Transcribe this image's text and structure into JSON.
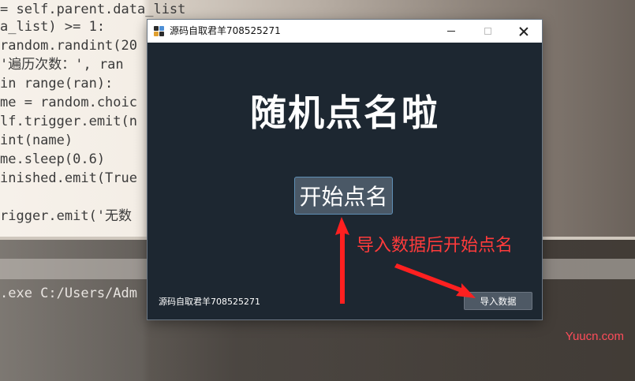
{
  "editor": {
    "code_lines": [
      "= self.parent.data_list",
      "a_list) >= 1:",
      "random.randint(20",
      "'遍历次数：', ran",
      "in range(ran):",
      "me = random.choic",
      "lf.trigger.emit(n",
      "int(name)",
      "me.sleep(0.6)",
      "inished.emit(True",
      "",
      "rigger.emit('无数"
    ],
    "terminal_line": ".exe C:/Users/Adm"
  },
  "window": {
    "title": "源码自取君羊708525271",
    "heading": "随机点名啦",
    "start_button_label": "开始点名",
    "hint_text": "导入数据后开始点名",
    "footer_text": "源码自取君羊708525271",
    "import_button_label": "导入数据"
  },
  "watermark": "Yuucn.com",
  "colors": {
    "window_bg": "#1d2731",
    "button_bg": "#4a5866",
    "accent_border": "#5f8fb5",
    "hint_red": "#ff3b3b",
    "arrow_red": "#ff2020"
  }
}
